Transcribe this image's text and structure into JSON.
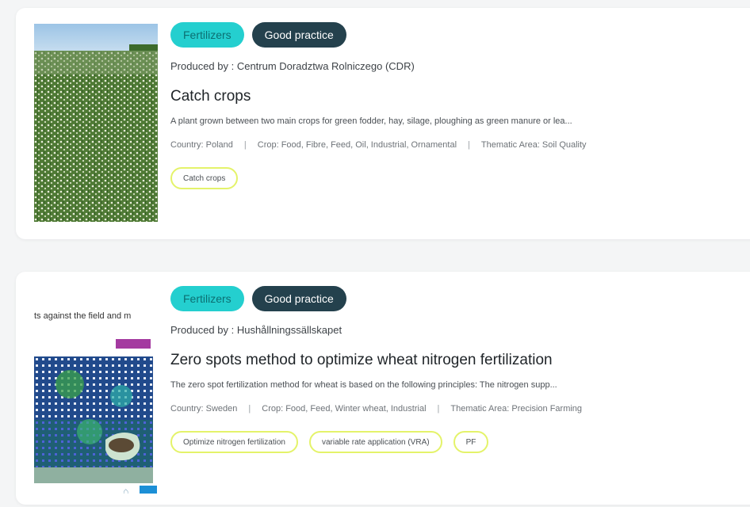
{
  "cards": [
    {
      "category": "Fertilizers",
      "type": "Good practice",
      "producer": "Produced by : Centrum Doradztwa Rolniczego (CDR)",
      "title": "Catch crops",
      "description": "A plant grown between two main crops for green fodder, hay, silage, ploughing as green manure or lea...",
      "country": "Country: Poland",
      "crop": "Crop: Food, Fibre, Feed, Oil, Industrial, Ornamental",
      "thematic": "Thematic Area: Soil Quality",
      "tags": [
        "Catch crops"
      ],
      "image": "buckwheat-field"
    },
    {
      "category": "Fertilizers",
      "type": "Good practice",
      "producer": "Produced by : Hushållningssällskapet",
      "title": "Zero spots method to optimize wheat nitrogen fertilization",
      "description": "The zero spot fertilization method for wheat is based on the following principles: The nitrogen supp...",
      "country": "Country: Sweden",
      "crop": "Crop: Food, Feed, Winter wheat, Industrial",
      "thematic": "Thematic Area: Precision Farming",
      "tags": [
        "Optimize nitrogen fertilization",
        "variable rate application (VRA)",
        "PF"
      ],
      "image": "field-map",
      "thumb_text": "ts against the field and m"
    }
  ],
  "colors": {
    "category_badge": "#24cfcf",
    "type_badge": "#24414d",
    "tag_border": "#e4f36a"
  }
}
